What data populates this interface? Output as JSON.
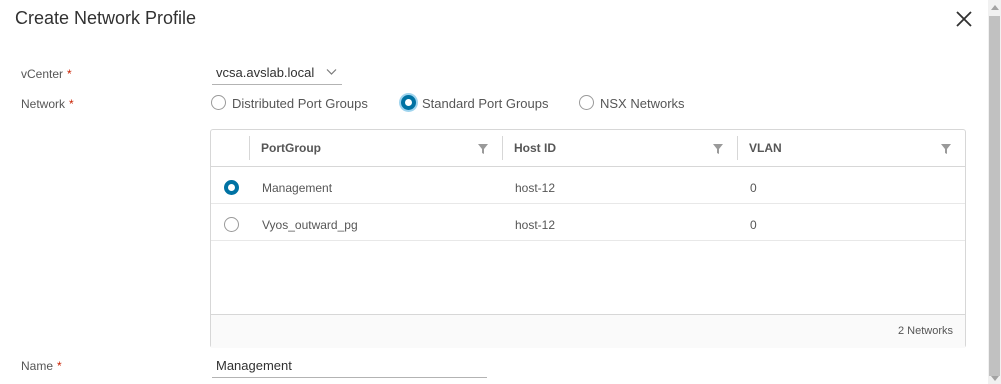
{
  "dialog": {
    "title": "Create Network Profile"
  },
  "form": {
    "vcenter": {
      "label": "vCenter",
      "required": "*",
      "value": "vcsa.avslab.local"
    },
    "network": {
      "label": "Network",
      "required": "*",
      "options": [
        "Distributed Port Groups",
        "Standard Port Groups",
        "NSX Networks"
      ],
      "selected": "Standard Port Groups"
    },
    "name": {
      "label": "Name",
      "required": "*",
      "value": "Management"
    }
  },
  "grid": {
    "columns": [
      "PortGroup",
      "Host ID",
      "VLAN"
    ],
    "rows": [
      {
        "portgroup": "Management",
        "host_id": "host-12",
        "vlan": "0",
        "selected": true
      },
      {
        "portgroup": "Vyos_outward_pg",
        "host_id": "host-12",
        "vlan": "0",
        "selected": false
      }
    ],
    "footer": "2 Networks"
  },
  "colors": {
    "accent": "#0072a3",
    "required": "#c92100"
  },
  "icons": {
    "close": "close-icon",
    "dropdown": "chevron-down-icon",
    "filter": "filter-icon"
  }
}
